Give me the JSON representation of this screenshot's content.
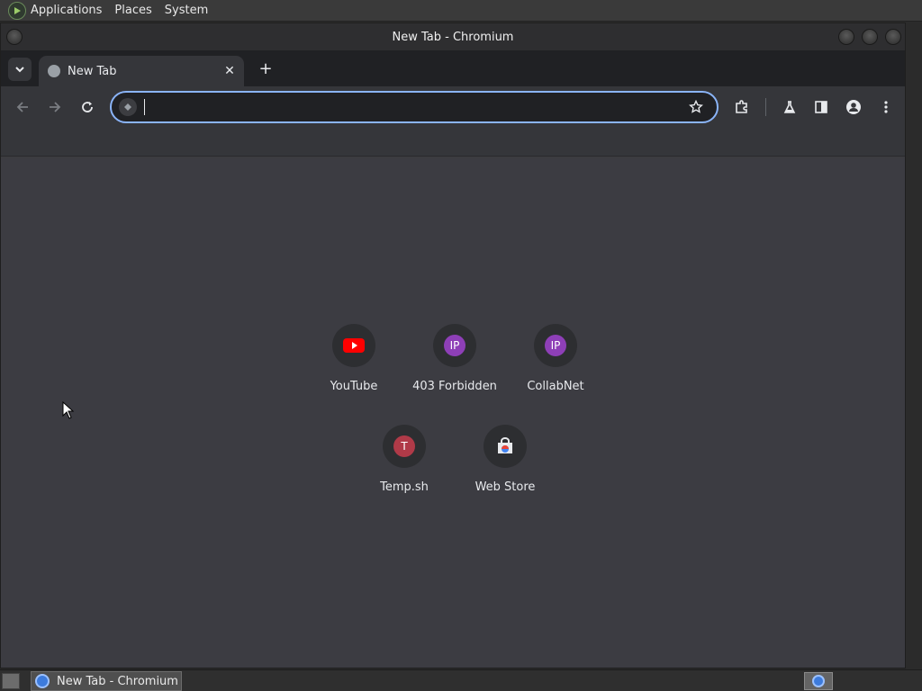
{
  "top_panel": {
    "menus": [
      "Applications",
      "Places",
      "System"
    ]
  },
  "window": {
    "title": "New Tab - Chromium"
  },
  "tab": {
    "title": "New Tab"
  },
  "toolbar": {
    "omnibox_value": ""
  },
  "shortcuts": [
    {
      "label": "YouTube",
      "icon": "youtube-icon"
    },
    {
      "label": "403 Forbidden",
      "icon": "ip-letter-icon",
      "letter": "IP",
      "color": "#8e3fb7"
    },
    {
      "label": "CollabNet",
      "icon": "ip-letter-icon",
      "letter": "IP",
      "color": "#8e3fb7"
    },
    {
      "label": "Temp.sh",
      "icon": "t-letter-icon",
      "letter": "T",
      "color": "#b03a48"
    },
    {
      "label": "Web Store",
      "icon": "web-store-icon"
    }
  ],
  "taskbar": {
    "task_label": "New Tab - Chromium"
  },
  "colors": {
    "accent": "#8ab4f8",
    "youtube_red": "#ff0000"
  }
}
